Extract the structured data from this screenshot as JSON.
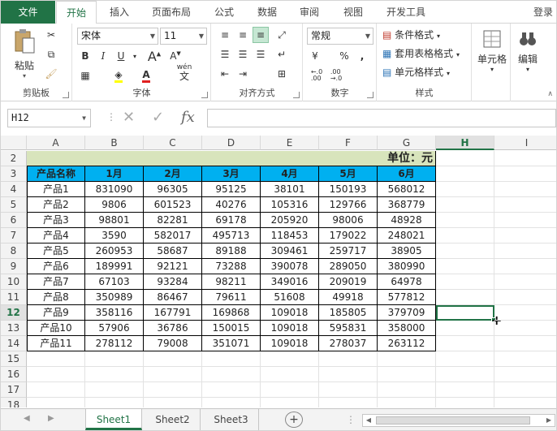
{
  "tabs": [
    "文件",
    "开始",
    "插入",
    "页面布局",
    "公式",
    "数据",
    "审阅",
    "视图",
    "开发工具"
  ],
  "login": "登录",
  "clipboard": {
    "paste": "粘贴",
    "label": "剪贴板"
  },
  "font": {
    "name": "宋体",
    "size": "11",
    "label": "字体",
    "bold": "B",
    "italic": "I",
    "underline": "U",
    "font_color_glyph": "A",
    "wen": "wén",
    "wen_char": "文"
  },
  "align": {
    "label": "对齐方式"
  },
  "number": {
    "format": "常规",
    "label": "数字",
    "percent": "%",
    "comma": ",",
    "inc": "←.0\n.00",
    "dec": ".00\n→.0"
  },
  "styles": {
    "cond": "条件格式",
    "table": "套用表格格式",
    "cell": "单元格样式",
    "label": "样式"
  },
  "cells": {
    "label": "单元格"
  },
  "editing": {
    "label": "编辑"
  },
  "formula_bar": {
    "name": "H12",
    "value": "",
    "cancel": "✕",
    "enter": "✓",
    "fx": "fx"
  },
  "columns": [
    "A",
    "B",
    "C",
    "D",
    "E",
    "F",
    "G",
    "H",
    "I"
  ],
  "rows": [
    "2",
    "3",
    "4",
    "5",
    "6",
    "7",
    "8",
    "9",
    "10",
    "11",
    "12",
    "13",
    "14",
    "15",
    "16",
    "17",
    "18"
  ],
  "table": {
    "unit_label": "单位：元",
    "headers": [
      "产品名称",
      "1月",
      "2月",
      "3月",
      "4月",
      "5月",
      "6月"
    ],
    "rows": [
      [
        "产品1",
        "831090",
        "96305",
        "95125",
        "38101",
        "150193",
        "568012"
      ],
      [
        "产品2",
        "9806",
        "601523",
        "40276",
        "105316",
        "129766",
        "368779"
      ],
      [
        "产品3",
        "98801",
        "82281",
        "69178",
        "205920",
        "98006",
        "48928"
      ],
      [
        "产品4",
        "3590",
        "582017",
        "495713",
        "118453",
        "179022",
        "248021"
      ],
      [
        "产品5",
        "260953",
        "58687",
        "89188",
        "309461",
        "259717",
        "38905"
      ],
      [
        "产品6",
        "189991",
        "92121",
        "73288",
        "390078",
        "289050",
        "380990"
      ],
      [
        "产品7",
        "67103",
        "93284",
        "98211",
        "349016",
        "209019",
        "64978"
      ],
      [
        "产品8",
        "350989",
        "86467",
        "79611",
        "51608",
        "49918",
        "577812"
      ],
      [
        "产品9",
        "358116",
        "167791",
        "169868",
        "109018",
        "185805",
        "379709"
      ],
      [
        "产品10",
        "57906",
        "36786",
        "150015",
        "109018",
        "595831",
        "358000"
      ],
      [
        "产品11",
        "278112",
        "79008",
        "351071",
        "109018",
        "278037",
        "263112"
      ]
    ]
  },
  "active_cell": "H12",
  "sheets": [
    "Sheet1",
    "Sheet2",
    "Sheet3"
  ],
  "add_sheet": "+",
  "colors": {
    "accent": "#217346",
    "header_fill": "#00b0f0",
    "unit_fill": "#d8e4bc"
  }
}
